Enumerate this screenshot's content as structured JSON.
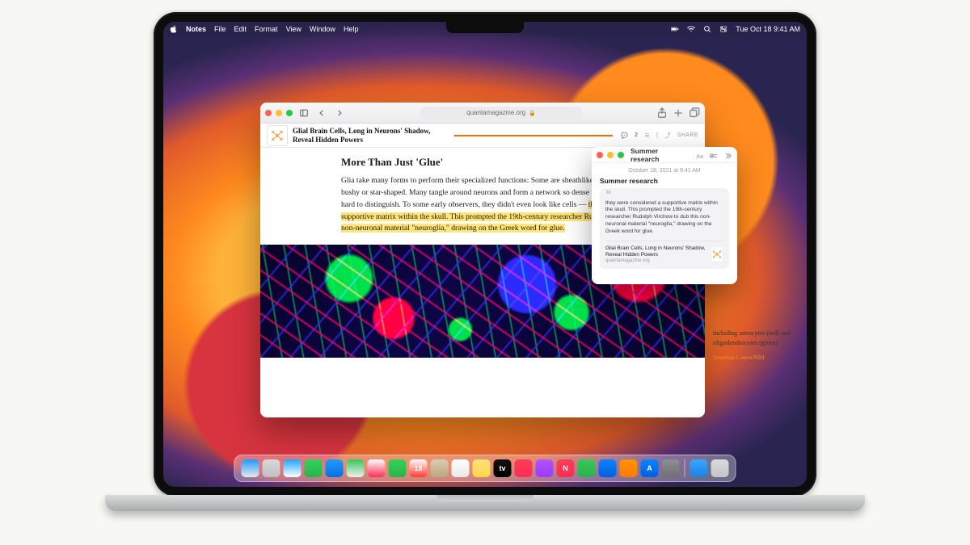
{
  "menubar": {
    "app": "Notes",
    "items": [
      "File",
      "Edit",
      "Format",
      "View",
      "Window",
      "Help"
    ],
    "datetime": "Tue Oct 18  9:41 AM"
  },
  "safari": {
    "url_display": "quantamagazine.org",
    "subbar_title": "Glial Brain Cells, Long in Neurons' Shadow, Reveal Hidden Powers",
    "comment_count": "2",
    "share_label": "SHARE",
    "article": {
      "heading": "More Than Just 'Glue'",
      "para_pre": "Glia take many forms to perform their specialized functions: Some are sheathlike, while others are spindly, bushy or star-shaped. Many tangle around neurons and form a network so dense that individual cells are hard to distinguish. To some early observers, they didn't even look like cells — ",
      "para_hl": "they were considered a supportive matrix within the skull. This prompted the 19th-century researcher Rudolph Virchow to dub this non-neuronal material \"neuroglia,\" drawing on the Greek word for glue.",
      "caption": "including astrocytes (red) and oligodendrocytes (green).",
      "credit": "Jonathan Cohen/NIH"
    }
  },
  "note": {
    "window_title": "Summer research",
    "timestamp": "October 18, 2021 at 9:41 AM",
    "heading": "Summer research",
    "quote": "they were considered a supportive matrix within the skull. This prompted the 19th-century researcher Rudolph Virchow to dub this non-neuronal material \"neuroglia,\" drawing on the Greek word for glue.",
    "link_title": "Glial Brain Cells, Long in Neurons' Shadow, Reveal Hidden Powers",
    "link_domain": "quantamagazine.org"
  },
  "dock": {
    "apps": [
      {
        "n": "finder",
        "c1": "#1e9bff",
        "c2": "#e8e8e8"
      },
      {
        "n": "launchpad",
        "c1": "#d8d8da",
        "c2": "#bfbfc2"
      },
      {
        "n": "safari",
        "c1": "#1fa7ff",
        "c2": "#ffffff"
      },
      {
        "n": "messages",
        "c1": "#33d15a",
        "c2": "#28b44c"
      },
      {
        "n": "mail",
        "c1": "#1e9bff",
        "c2": "#0a6fe0"
      },
      {
        "n": "maps",
        "c1": "#34c759",
        "c2": "#f0efef"
      },
      {
        "n": "photos",
        "c1": "#ffffff",
        "c2": "#ff2d55"
      },
      {
        "n": "facetime",
        "c1": "#33d15a",
        "c2": "#28b44c"
      },
      {
        "n": "calendar",
        "c1": "#ffffff",
        "c2": "#ff3b30",
        "t": "18"
      },
      {
        "n": "contacts",
        "c1": "#d9cbb6",
        "c2": "#bca77f"
      },
      {
        "n": "reminders",
        "c1": "#ffffff",
        "c2": "#e8e8ea"
      },
      {
        "n": "notes",
        "c1": "#ffe27a",
        "c2": "#ffd54a"
      },
      {
        "n": "tv",
        "c1": "#111111",
        "c2": "#000000",
        "t": "tv"
      },
      {
        "n": "music",
        "c1": "#ff3b57",
        "c2": "#ff2d55"
      },
      {
        "n": "podcasts",
        "c1": "#b452ff",
        "c2": "#9a3cff"
      },
      {
        "n": "news",
        "c1": "#ff3b57",
        "c2": "#ff2d55",
        "t": "N"
      },
      {
        "n": "numbers",
        "c1": "#34c759",
        "c2": "#28b44c"
      },
      {
        "n": "keynote",
        "c1": "#0a84ff",
        "c2": "#0060df"
      },
      {
        "n": "pages",
        "c1": "#ff9500",
        "c2": "#ff7a00"
      },
      {
        "n": "appstore",
        "c1": "#0a84ff",
        "c2": "#0060df",
        "t": "A"
      },
      {
        "n": "settings",
        "c1": "#8e8e93",
        "c2": "#6f6f74"
      }
    ],
    "right": [
      {
        "n": "downloads",
        "c1": "#36a7ff",
        "c2": "#1e82e0"
      },
      {
        "n": "trash",
        "c1": "#dcdcde",
        "c2": "#c4c4c7"
      }
    ]
  }
}
